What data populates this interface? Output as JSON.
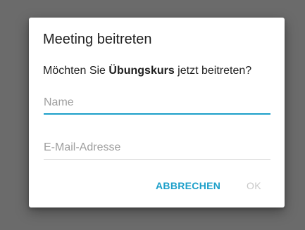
{
  "dialog": {
    "title": "Meeting beitreten",
    "message_prefix": "Möchten Sie ",
    "course_name": "Übungskurs",
    "message_suffix": " jetzt beitreten?",
    "name_field": {
      "placeholder": "Name",
      "value": ""
    },
    "email_field": {
      "placeholder": "E-Mail-Adresse",
      "value": ""
    },
    "cancel_label": "ABBRECHEN",
    "ok_label": "OK"
  },
  "colors": {
    "accent": "#1c9fc9",
    "scrim": "#6b6b6b",
    "disabled": "#c8c8c8"
  }
}
